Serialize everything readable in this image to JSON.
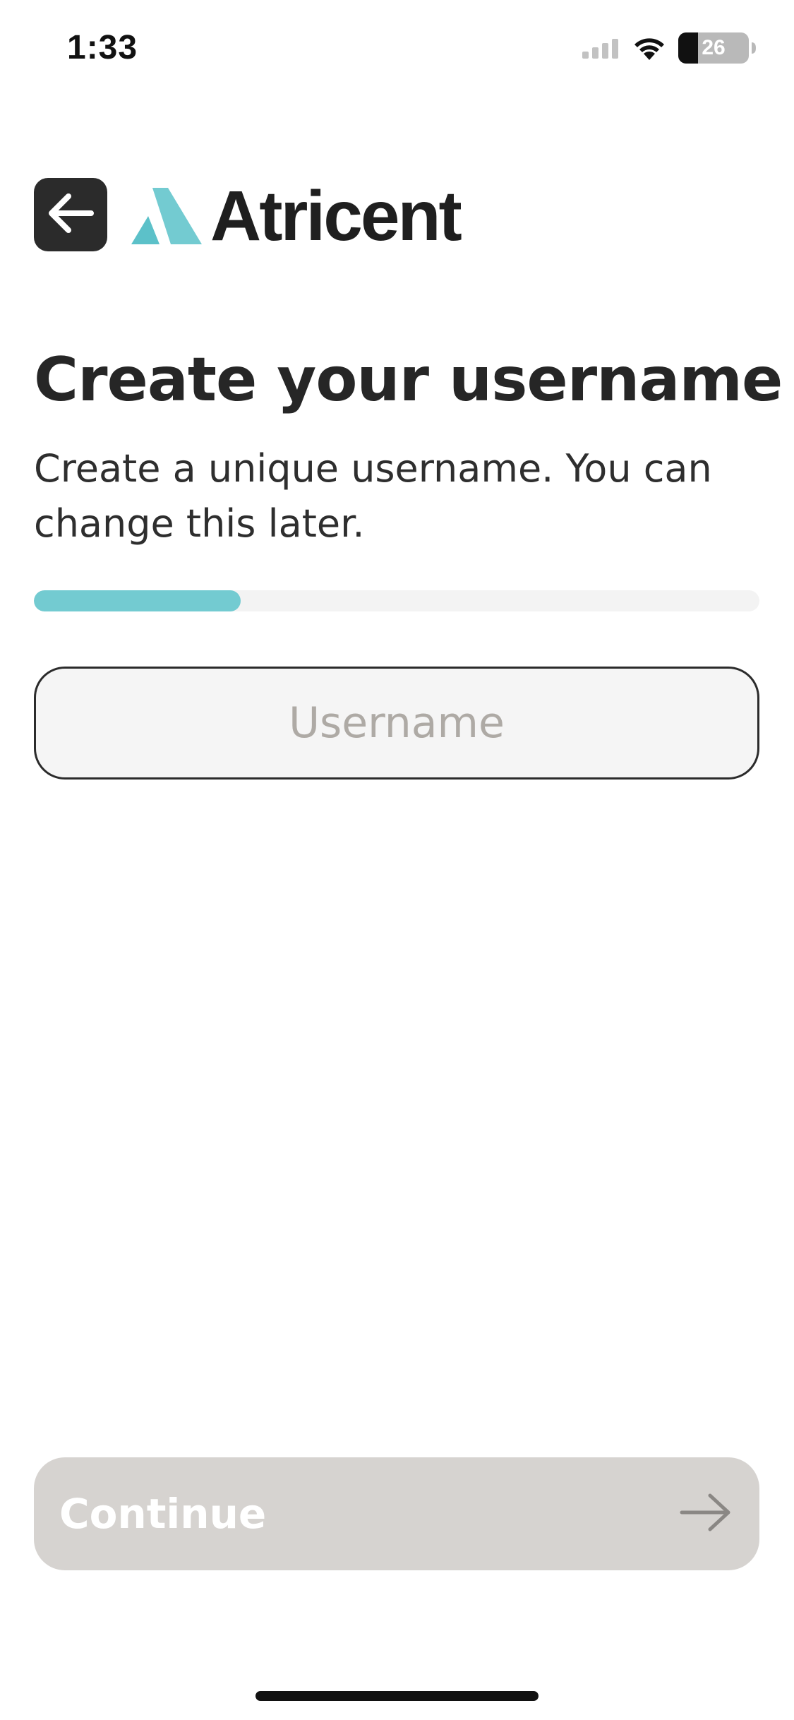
{
  "status_bar": {
    "time": "1:33",
    "battery_level": "26",
    "icons": [
      "signal-icon",
      "wifi-icon",
      "battery-icon"
    ]
  },
  "header": {
    "back_icon": "arrow-left-icon",
    "brand_name": "Atricent"
  },
  "main": {
    "title": "Create your username",
    "subtitle": "Create a unique username. You can change this later.",
    "progress": 0.285,
    "username": {
      "value": "",
      "placeholder": "Username"
    }
  },
  "footer": {
    "continue_label": "Continue",
    "continue_icon": "arrow-right-icon"
  },
  "colors": {
    "accent": "#73cbd1",
    "button_disabled": "#d6d3d0",
    "text_primary": "#262626",
    "placeholder": "#aeaaa5"
  }
}
